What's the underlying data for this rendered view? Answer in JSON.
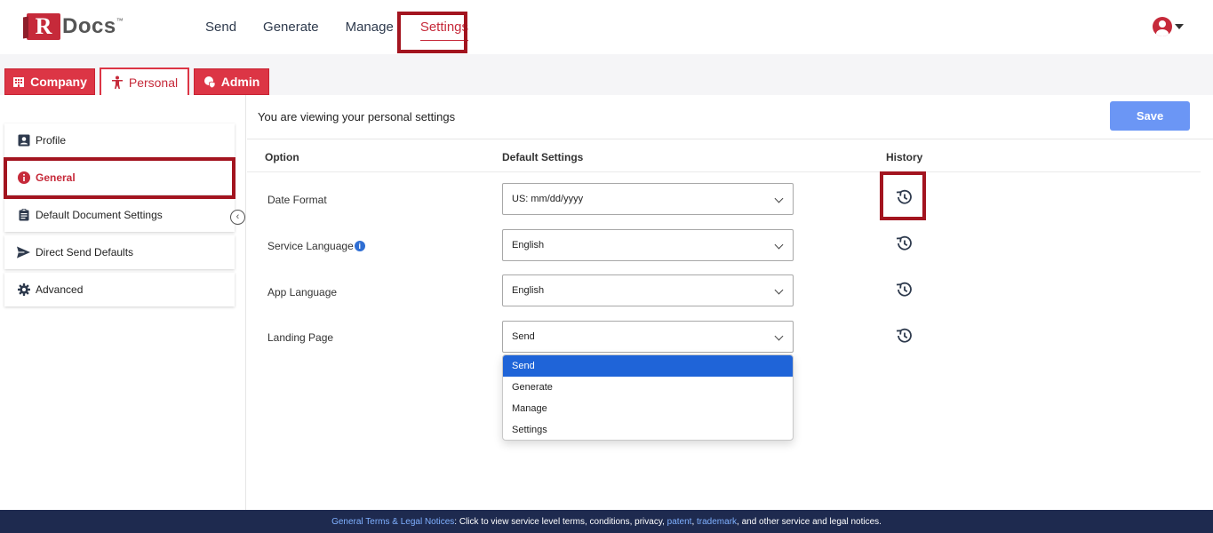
{
  "logo": {
    "letter": "R",
    "text": "Docs",
    "tm": "™"
  },
  "nav": {
    "items": [
      "Send",
      "Generate",
      "Manage",
      "Settings"
    ],
    "active": "Settings"
  },
  "tabs": [
    {
      "label": "Company",
      "icon": "building-icon"
    },
    {
      "label": "Personal",
      "icon": "person-icon"
    },
    {
      "label": "Admin",
      "icon": "shield-icon"
    }
  ],
  "sidebar": {
    "items": [
      {
        "label": "Profile",
        "icon": "id-card-icon"
      },
      {
        "label": "General",
        "icon": "info-icon",
        "active": true
      },
      {
        "label": "Default Document Settings",
        "icon": "clipboard-icon"
      },
      {
        "label": "Direct Send Defaults",
        "icon": "paper-plane-icon"
      },
      {
        "label": "Advanced",
        "icon": "gear-icon"
      }
    ],
    "collapse": "‹"
  },
  "main": {
    "viewing_text": "You are viewing your personal settings",
    "save_label": "Save",
    "headers": {
      "option": "Option",
      "default": "Default Settings",
      "history": "History"
    },
    "rows": [
      {
        "label": "Date Format",
        "value": "US: mm/dd/yyyy"
      },
      {
        "label": "Service Language",
        "value": "English",
        "info": "i"
      },
      {
        "label": "App Language",
        "value": "English"
      },
      {
        "label": "Landing Page",
        "value": "Send"
      }
    ],
    "dropdown_options": [
      "Send",
      "Generate",
      "Manage",
      "Settings"
    ]
  },
  "footer": {
    "link1": "General Terms & Legal Notices",
    "text1": ": Click to view service level terms, conditions, privacy, ",
    "link2": "patent",
    "sep": ", ",
    "link3": "trademark",
    "text2": ", and other service and legal notices."
  },
  "colors": {
    "brand": "#c62a3a",
    "save": "#6b96f5",
    "footer": "#1e2a4f",
    "highlight": "#a3141f"
  }
}
